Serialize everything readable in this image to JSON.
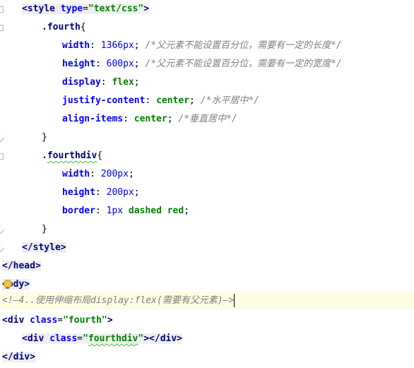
{
  "editor": {
    "lines": [
      {
        "segments": [
          {
            "t": "<",
            "c": "tag hl"
          },
          {
            "t": "style",
            "c": "tag hl"
          },
          {
            "t": " ",
            "c": "hl"
          },
          {
            "t": "type",
            "c": "attr hl"
          },
          {
            "t": "=",
            "c": "punct hl"
          },
          {
            "t": "\"text/css\"",
            "c": "str hl"
          },
          {
            "t": ">",
            "c": "tag hl"
          }
        ]
      },
      {
        "segments": [
          {
            "t": ".fourth",
            "c": "sel"
          },
          {
            "t": "{",
            "c": "punct"
          }
        ]
      },
      {
        "segments": [
          {
            "t": "width",
            "c": "prop"
          },
          {
            "t": ": ",
            "c": "punct"
          },
          {
            "t": "1366px",
            "c": "num"
          },
          {
            "t": "; ",
            "c": "punct"
          },
          {
            "t": "/*父元素不能设置百分位，需要有一定的长度*/",
            "c": "cmt"
          }
        ]
      },
      {
        "segments": [
          {
            "t": "height",
            "c": "prop"
          },
          {
            "t": ": ",
            "c": "punct"
          },
          {
            "t": "600px",
            "c": "num"
          },
          {
            "t": "; ",
            "c": "punct"
          },
          {
            "t": "/*父元素不能设置百分位，需要有一定的宽度*/",
            "c": "cmt"
          }
        ]
      },
      {
        "segments": [
          {
            "t": "display",
            "c": "prop"
          },
          {
            "t": ": ",
            "c": "punct"
          },
          {
            "t": "flex",
            "c": "kw"
          },
          {
            "t": ";",
            "c": "punct"
          }
        ]
      },
      {
        "segments": [
          {
            "t": "justify-content",
            "c": "prop"
          },
          {
            "t": ": ",
            "c": "punct"
          },
          {
            "t": "center",
            "c": "kw"
          },
          {
            "t": "; ",
            "c": "punct"
          },
          {
            "t": "/*水平居中*/",
            "c": "cmt"
          }
        ]
      },
      {
        "segments": [
          {
            "t": "align-items",
            "c": "prop"
          },
          {
            "t": ": ",
            "c": "punct"
          },
          {
            "t": "center",
            "c": "kw"
          },
          {
            "t": "; ",
            "c": "punct"
          },
          {
            "t": "/*垂直居中*/",
            "c": "cmt"
          }
        ]
      },
      {
        "segments": [
          {
            "t": "}",
            "c": "punct"
          }
        ]
      },
      {
        "segments": [
          {
            "t": ".",
            "c": "sel"
          },
          {
            "t": "fourthdiv",
            "c": "sel squig"
          },
          {
            "t": "{",
            "c": "punct"
          }
        ]
      },
      {
        "segments": [
          {
            "t": "width",
            "c": "prop"
          },
          {
            "t": ": ",
            "c": "punct"
          },
          {
            "t": "200px",
            "c": "num"
          },
          {
            "t": ";",
            "c": "punct"
          }
        ]
      },
      {
        "segments": [
          {
            "t": "height",
            "c": "prop"
          },
          {
            "t": ": ",
            "c": "punct"
          },
          {
            "t": "200px",
            "c": "num"
          },
          {
            "t": ";",
            "c": "punct"
          }
        ]
      },
      {
        "segments": [
          {
            "t": "border",
            "c": "prop"
          },
          {
            "t": ": ",
            "c": "punct"
          },
          {
            "t": "1px",
            "c": "num"
          },
          {
            "t": " dashed red",
            "c": "kw"
          },
          {
            "t": ";",
            "c": "punct"
          }
        ]
      },
      {
        "segments": [
          {
            "t": "}",
            "c": "punct"
          }
        ]
      },
      {
        "segments": [
          {
            "t": "</style>",
            "c": "tag hl"
          }
        ]
      },
      {
        "segments": [
          {
            "t": "</head>",
            "c": "tag hl"
          }
        ]
      },
      {
        "segments": [
          {
            "t": "<",
            "c": "tag hl"
          },
          {
            "icon": "lightbulb-icon"
          },
          {
            "t": "ody>",
            "c": "tag hl"
          }
        ]
      },
      {
        "segments": [
          {
            "t": "<!—4..使用伸缩布局display:flex(需要有父元素)—>",
            "c": "cmt"
          },
          {
            "caret": true
          }
        ]
      },
      {
        "segments": [
          {
            "t": "<",
            "c": "tag"
          },
          {
            "t": "div",
            "c": "tag"
          },
          {
            "t": " ",
            "c": "punct"
          },
          {
            "t": "class",
            "c": "attr"
          },
          {
            "t": "=",
            "c": "punct"
          },
          {
            "t": "\"fourth\"",
            "c": "str"
          },
          {
            "t": ">",
            "c": "tag"
          }
        ]
      },
      {
        "segments": [
          {
            "t": "<",
            "c": "tag hl"
          },
          {
            "t": "div",
            "c": "tag hl"
          },
          {
            "t": " ",
            "c": "hl"
          },
          {
            "t": "class",
            "c": "attr hl"
          },
          {
            "t": "=",
            "c": "punct hl"
          },
          {
            "t": "\"",
            "c": "str hl"
          },
          {
            "t": "fourthdiv",
            "c": "str hl squig"
          },
          {
            "t": "\"",
            "c": "str hl"
          },
          {
            "t": "></div>",
            "c": "tag hl"
          }
        ]
      },
      {
        "segments": [
          {
            "t": "</div>",
            "c": "tag hl"
          }
        ]
      }
    ]
  }
}
